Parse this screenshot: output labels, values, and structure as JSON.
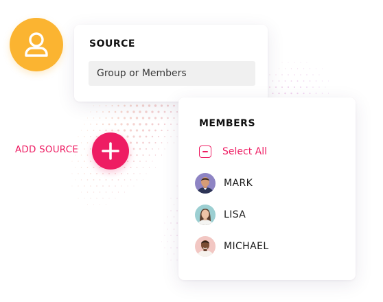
{
  "source_card": {
    "title": "SOURCE",
    "input_placeholder": "Group or Members",
    "input_value": ""
  },
  "add_source": {
    "label": "ADD SOURCE",
    "icon": "plus-icon"
  },
  "user_badge": {
    "icon": "user-icon"
  },
  "members_card": {
    "title": "MEMBERS",
    "select_all_label": "Select All",
    "members": [
      {
        "name": "MARK",
        "avatar": "avatar-mark"
      },
      {
        "name": "LISA",
        "avatar": "avatar-lisa"
      },
      {
        "name": "MICHAEL",
        "avatar": "avatar-michael"
      }
    ]
  },
  "colors": {
    "accent": "#ee1d63",
    "badge": "#fbb431",
    "input_bg": "#f0f0f0"
  }
}
